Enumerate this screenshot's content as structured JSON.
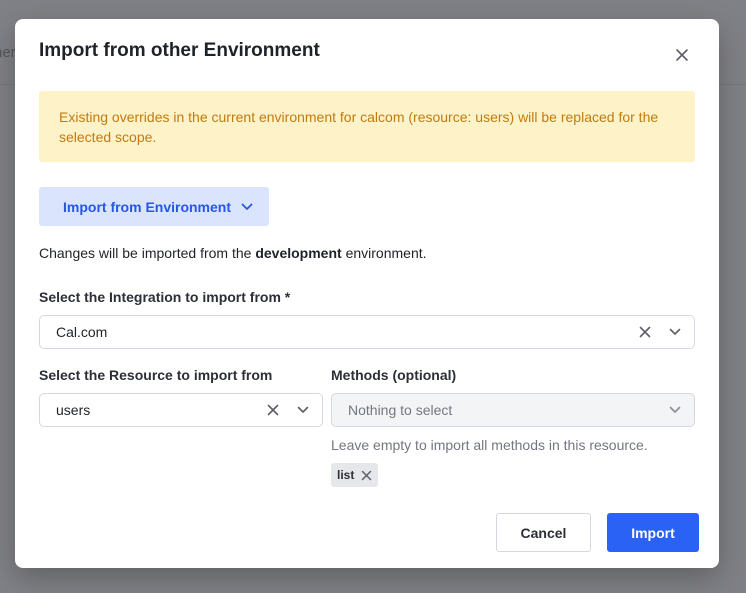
{
  "background": {
    "partial_text": "ner"
  },
  "modal": {
    "title": "Import from other Environment",
    "warning": "Existing overrides in the current environment for calcom (resource: users) will be replaced for the selected scope.",
    "env_button_label": "Import from Environment",
    "changes_prefix": "Changes will be imported from the ",
    "changes_env": "development",
    "changes_suffix": " environment.",
    "integration": {
      "label": "Select the Integration to import from *",
      "value": "Cal.com"
    },
    "resource": {
      "label": "Select the Resource to import from",
      "value": "users"
    },
    "methods": {
      "label": "Methods (optional)",
      "placeholder": "Nothing to select",
      "hint": "Leave empty to import all methods in this resource.",
      "tags": [
        "list"
      ]
    },
    "cancel_label": "Cancel",
    "import_label": "Import"
  },
  "colors": {
    "primary": "#2a62f5",
    "warning_bg": "#fdf2c8",
    "warning_text": "#c47a12",
    "env_button_bg": "#dae5fd"
  },
  "icons": {
    "close": "close-icon",
    "chevron": "chevron-down-icon",
    "clear": "clear-icon"
  }
}
